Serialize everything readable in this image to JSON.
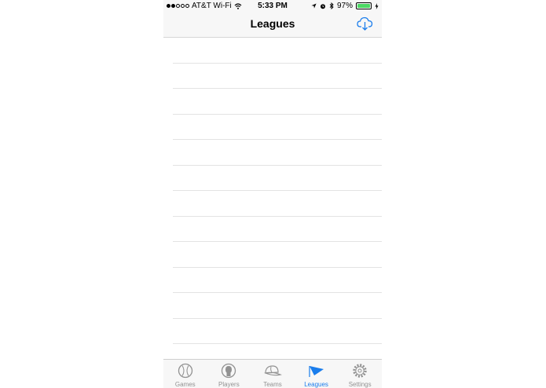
{
  "status_bar": {
    "carrier": "AT&T Wi-Fi",
    "time": "5:33 PM",
    "battery": "97%",
    "signal_icon": "signal-dots-icon",
    "wifi_icon": "wifi-icon",
    "location_icon": "location-arrow-icon",
    "alarm_icon": "alarm-icon",
    "bluetooth_icon": "bluetooth-icon",
    "battery_icon": "battery-icon",
    "charging_icon": "charging-bolt-icon"
  },
  "nav": {
    "title": "Leagues",
    "download_icon": "cloud-download-icon"
  },
  "list": {
    "row_count": 12
  },
  "tabs": [
    {
      "label": "Games",
      "icon": "baseball-icon",
      "active": false
    },
    {
      "label": "Players",
      "icon": "player-head-icon",
      "active": false
    },
    {
      "label": "Teams",
      "icon": "cap-icon",
      "active": false
    },
    {
      "label": "Leagues",
      "icon": "flag-icon",
      "active": true
    },
    {
      "label": "Settings",
      "icon": "gear-icon",
      "active": false
    }
  ],
  "colors": {
    "accent": "#1a7dec",
    "tab_inactive": "#929292",
    "bar_background": "#f7f7f7",
    "battery": "#4cd964"
  }
}
